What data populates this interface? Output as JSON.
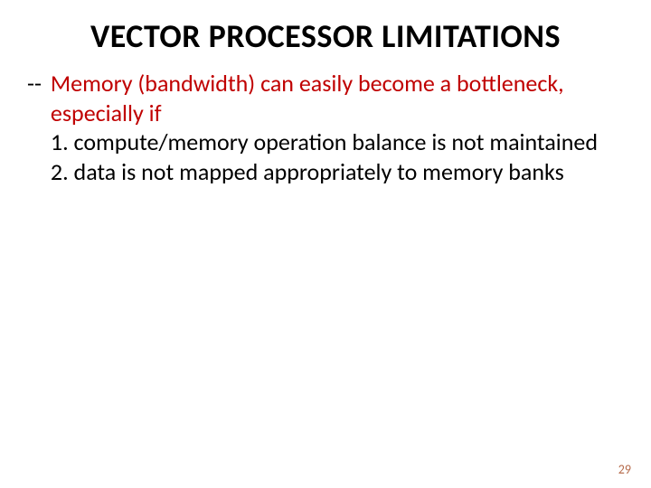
{
  "title": "VECTOR PROCESSOR LIMITATIONS",
  "lead": {
    "marker": "--",
    "text": "Memory (bandwidth) can easily become a bottleneck, especially if"
  },
  "points": [
    "1. compute/memory operation balance is not maintained",
    "2. data is not mapped appropriately to memory banks"
  ],
  "page_number": "29"
}
